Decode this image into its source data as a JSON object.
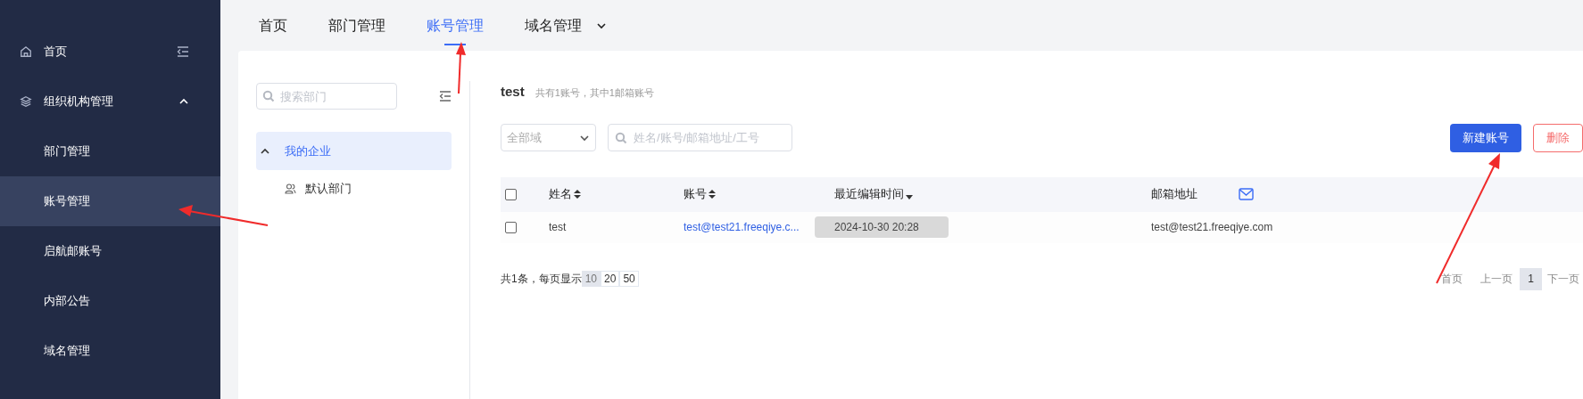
{
  "sidebar": {
    "items": [
      {
        "label": "首页",
        "kind": "nav",
        "selected": false
      },
      {
        "label": "组织机构管理",
        "kind": "group",
        "expanded": true,
        "selected": false
      },
      {
        "label": "部门管理",
        "kind": "sub",
        "selected": false
      },
      {
        "label": "账号管理",
        "kind": "sub",
        "selected": true
      },
      {
        "label": "启航邮账号",
        "kind": "sub",
        "selected": false
      },
      {
        "label": "内部公告",
        "kind": "sub",
        "selected": false
      },
      {
        "label": "域名管理",
        "kind": "sub",
        "selected": false
      }
    ]
  },
  "tabs": [
    {
      "label": "首页",
      "selected": false
    },
    {
      "label": "部门管理",
      "selected": false
    },
    {
      "label": "账号管理",
      "selected": true
    },
    {
      "label": "域名管理",
      "selected": false
    }
  ],
  "dept_panel": {
    "search": {
      "placeholder": "搜索部门"
    },
    "tree": [
      {
        "label": "我的企业",
        "expanded": true,
        "selected": true,
        "children": [
          {
            "label": "默认部门",
            "selected": false
          }
        ]
      }
    ]
  },
  "accounts": {
    "title": "test",
    "summary": "共有1账号，其中1邮箱账号",
    "domain_select": {
      "value": "全部域"
    },
    "search": {
      "placeholder": "姓名/账号/邮箱地址/工号"
    },
    "buttons": [
      {
        "label": "新建账号",
        "kind": "primary"
      },
      {
        "label": "删除",
        "kind": "danger"
      }
    ],
    "table": {
      "header_checked": false,
      "columns": [
        {
          "label": "姓名",
          "sortable": true,
          "sorted_desc": false
        },
        {
          "label": "账号",
          "sortable": true,
          "sorted_desc": false
        },
        {
          "label": "最近编辑时间",
          "sortable": true,
          "sorted_desc": true
        },
        {
          "label": "邮箱地址"
        }
      ],
      "rows": [
        {
          "checked": false,
          "cells": [
            "test",
            "test@test21.freeqiye.c...",
            "2024-10-30 20:28",
            "test@test21.freeqiye.com"
          ]
        }
      ]
    },
    "pagination": {
      "total": "共1条，每页显示",
      "page_sizes": [
        {
          "label": "10",
          "selected": true
        },
        {
          "label": "20",
          "selected": false
        },
        {
          "label": "50",
          "selected": false
        }
      ],
      "first": "首页",
      "prev": "上一页",
      "pages": [
        {
          "label": "1",
          "selected": true
        }
      ],
      "next": "下一页"
    }
  }
}
